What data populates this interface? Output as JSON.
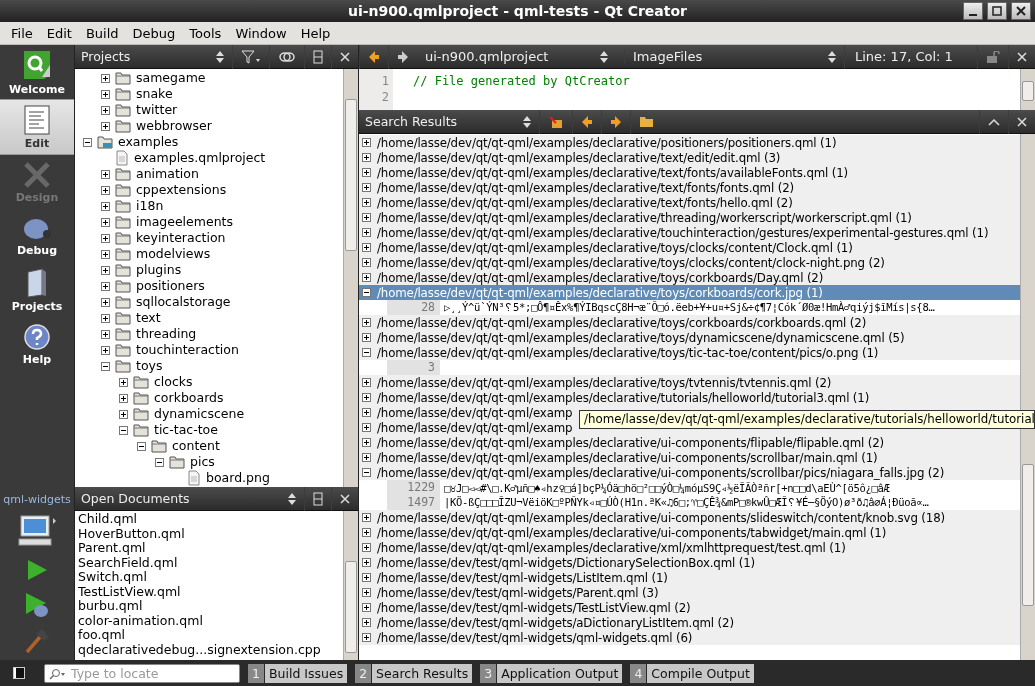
{
  "window": {
    "title": "ui-n900.qmlproject - qml-tests - Qt Creator"
  },
  "menu": [
    "File",
    "Edit",
    "Build",
    "Debug",
    "Tools",
    "Window",
    "Help"
  ],
  "modes": [
    {
      "kind": "welcome",
      "label": "Welcome",
      "selected": false,
      "disabled": false
    },
    {
      "kind": "edit",
      "label": "Edit",
      "selected": true,
      "disabled": false
    },
    {
      "kind": "design",
      "label": "Design",
      "selected": false,
      "disabled": true
    },
    {
      "kind": "debug",
      "label": "Debug",
      "selected": false,
      "disabled": false
    },
    {
      "kind": "projects",
      "label": "Projects",
      "selected": false,
      "disabled": false
    },
    {
      "kind": "help",
      "label": "Help",
      "selected": false,
      "disabled": false
    }
  ],
  "run_target": {
    "label": "qml-widgets"
  },
  "projects": {
    "title": "Projects",
    "tree": [
      {
        "children": [
          {
            "kind": "folder",
            "label": "samegame",
            "expanded": false
          },
          {
            "kind": "folder",
            "label": "snake",
            "expanded": false
          },
          {
            "kind": "folder",
            "label": "twitter",
            "expanded": false
          },
          {
            "kind": "folder",
            "label": "webbrowser",
            "expanded": false
          }
        ]
      },
      {
        "kind": "project",
        "label": "examples",
        "expanded": true,
        "children": [
          {
            "kind": "file",
            "label": "examples.qmlproject"
          },
          {
            "kind": "folder",
            "label": "animation",
            "expanded": false
          },
          {
            "kind": "folder",
            "label": "cppextensions",
            "expanded": false
          },
          {
            "kind": "folder",
            "label": "i18n",
            "expanded": false
          },
          {
            "kind": "folder",
            "label": "imageelements",
            "expanded": false
          },
          {
            "kind": "folder",
            "label": "keyinteraction",
            "expanded": false
          },
          {
            "kind": "folder",
            "label": "modelviews",
            "expanded": false
          },
          {
            "kind": "folder",
            "label": "plugins",
            "expanded": false
          },
          {
            "kind": "folder",
            "label": "positioners",
            "expanded": false
          },
          {
            "kind": "folder",
            "label": "sqllocalstorage",
            "expanded": false
          },
          {
            "kind": "folder",
            "label": "text",
            "expanded": false
          },
          {
            "kind": "folder",
            "label": "threading",
            "expanded": false
          },
          {
            "kind": "folder",
            "label": "touchinteraction",
            "expanded": false
          },
          {
            "kind": "folder",
            "label": "toys",
            "expanded": true,
            "children": [
              {
                "kind": "folder",
                "label": "clocks",
                "expanded": false
              },
              {
                "kind": "folder",
                "label": "corkboards",
                "expanded": false
              },
              {
                "kind": "folder",
                "label": "dynamicscene",
                "expanded": false
              },
              {
                "kind": "folder",
                "label": "tic-tac-toe",
                "expanded": true,
                "children": [
                  {
                    "kind": "folder",
                    "label": "content",
                    "expanded": true,
                    "children": [
                      {
                        "kind": "folder",
                        "label": "pics",
                        "expanded": true,
                        "children": [
                          {
                            "kind": "file",
                            "label": "board.png"
                          }
                        ]
                      }
                    ]
                  }
                ]
              }
            ]
          }
        ]
      }
    ]
  },
  "open_documents": {
    "title": "Open Documents",
    "items": [
      "Child.qml",
      "HoverButton.qml",
      "Parent.qml",
      "SearchField.qml",
      "Switch.qml",
      "TestListView.qml",
      "burbu.qml",
      "color-animation.qml",
      "foo.qml",
      "qdeclarativedebug...signextension.cpp"
    ]
  },
  "editor": {
    "project": "ui-n900.qmlproject",
    "file": "ImageFiles",
    "position": "Line: 17, Col: 1",
    "lines": [
      {
        "number": "1",
        "text": "// File generated by QtCreator"
      },
      {
        "number": "2"
      }
    ]
  },
  "search_results": {
    "title": "Search Results",
    "tooltip": "/home/lasse/dev/qt/qt-qml/examples/declarative/tutorials/helloworld/tutorial",
    "results": [
      {
        "text": "/home/lasse/dev/qt/qt-qml/examples/declarative/positioners/positioners.qml (1)",
        "expanded": false,
        "selected": false
      },
      {
        "text": "/home/lasse/dev/qt/qt-qml/examples/declarative/text/edit/edit.qml (3)",
        "expanded": false,
        "selected": false
      },
      {
        "text": "/home/lasse/dev/qt/qt-qml/examples/declarative/text/fonts/availableFonts.qml (1)",
        "expanded": false,
        "selected": false
      },
      {
        "text": "/home/lasse/dev/qt/qt-qml/examples/declarative/text/fonts/fonts.qml (2)",
        "expanded": false,
        "selected": false
      },
      {
        "text": "/home/lasse/dev/qt/qt-qml/examples/declarative/text/fonts/hello.qml (2)",
        "expanded": false,
        "selected": false
      },
      {
        "text": "/home/lasse/dev/qt/qt-qml/examples/declarative/threading/workerscript/workerscript.qml (1)",
        "expanded": false,
        "selected": false
      },
      {
        "text": "/home/lasse/dev/qt/qt-qml/examples/declarative/touchinteraction/gestures/experimental-gestures.qml (1)",
        "expanded": false,
        "selected": false
      },
      {
        "text": "/home/lasse/dev/qt/qt-qml/examples/declarative/toys/clocks/content/Clock.qml (1)",
        "expanded": false,
        "selected": false
      },
      {
        "text": "/home/lasse/dev/qt/qt-qml/examples/declarative/toys/clocks/content/clock-night.png (2)",
        "expanded": false,
        "selected": false
      },
      {
        "text": "/home/lasse/dev/qt/qt-qml/examples/declarative/toys/corkboards/Day.qml (2)",
        "expanded": false,
        "selected": false
      },
      {
        "text": "/home/lasse/dev/qt/qt-qml/examples/declarative/toys/corkboards/cork.jpg (1)",
        "expanded": true,
        "selected": true,
        "matches": [
          {
            "line": "28",
            "text": "▷¸¸Ý^ü`ÝN³␦5*;□Ô¶¤Êx%¶ÝIBqscÇ8H¬æ¨Õ□ó.ëeb+¥+u¤+Sj&÷¢¶7¦Cók´Ø0æ!HmÀ♂qiýj$ĩMís|s{8…"
          }
        ]
      },
      {
        "text": "/home/lasse/dev/qt/qt-qml/examples/declarative/toys/corkboards/corkboards.qml (2)",
        "expanded": false,
        "selected": false
      },
      {
        "text": "/home/lasse/dev/qt/qt-qml/examples/declarative/toys/dynamicscene/dynamicscene.qml (5)",
        "expanded": false,
        "selected": false
      },
      {
        "text": "/home/lasse/dev/qt/qt-qml/examples/declarative/toys/tic-tac-toe/content/pics/o.png (1)",
        "expanded": true,
        "selected": false,
        "matches": [
          {
            "line": "3"
          }
        ]
      },
      {
        "text": "/home/lasse/dev/qt/qt-qml/examples/declarative/toys/tvtennis/tvtennis.qml (2)",
        "expanded": false,
        "selected": false
      },
      {
        "text": "/home/lasse/dev/qt/qt-qml/examples/declarative/tutorials/helloworld/tutorial3.qml (1)",
        "expanded": false,
        "selected": false
      },
      {
        "text": "/home/lasse/dev/qt/qt-qml/examp",
        "expanded": false,
        "selected": false
      },
      {
        "text": "/home/lasse/dev/qt/qt-qml/examp",
        "expanded": false,
        "selected": false
      },
      {
        "text": "/home/lasse/dev/qt/qt-qml/examples/declarative/ui-components/flipable/flipable.qml (2)",
        "expanded": false,
        "selected": false
      },
      {
        "text": "/home/lasse/dev/qt/qt-qml/examples/declarative/ui-components/scrollbar/main.qml (1)",
        "expanded": false,
        "selected": false
      },
      {
        "text": "/home/lasse/dev/qt/qt-qml/examples/declarative/ui-components/scrollbar/pics/niagara_falls.jpg (2)",
        "expanded": true,
        "selected": false,
        "matches": [
          {
            "line": "1229",
            "text": "□♉J□◅◅#\\□.K♂µñ□♠◃hz♀□á]bçP¼Óä□hö□²□□ýÒ□¼móµS9Ç◃½ëĨÃÒªñr[+n□□d\\aEÙ^[ö5ô¿□âÆ"
          },
          {
            "line": "1497",
            "text": "|KÖ-ßÇ□□□ĨZU¬VëiöK□ºPÑYk◃¤□ÚÒ(H1n.ªK«♫6□;♈□ÇÊ¾&mP□®kwÛ□ÆĨ␦¥É─§ÖýO)ø³ð♫â⌀Á¦Ðüoã∝…"
          }
        ]
      },
      {
        "text": "/home/lasse/dev/qt/qt-qml/examples/declarative/ui-components/slideswitch/content/knob.svg (18)",
        "expanded": false,
        "selected": false
      },
      {
        "text": "/home/lasse/dev/qt/qt-qml/examples/declarative/ui-components/tabwidget/main.qml (1)",
        "expanded": false,
        "selected": false
      },
      {
        "text": "/home/lasse/dev/qt/qt-qml/examples/declarative/xml/xmlhttprequest/test.qml (1)",
        "expanded": false,
        "selected": false
      },
      {
        "text": "/home/lasse/dev/test/qml-widgets/DictionarySelectionBox.qml (1)",
        "expanded": false,
        "selected": false
      },
      {
        "text": "/home/lasse/dev/test/qml-widgets/ListItem.qml (1)",
        "expanded": false,
        "selected": false
      },
      {
        "text": "/home/lasse/dev/test/qml-widgets/Parent.qml (3)",
        "expanded": false,
        "selected": false
      },
      {
        "text": "/home/lasse/dev/test/qml-widgets/TestListView.qml (2)",
        "expanded": false,
        "selected": false
      },
      {
        "text": "/home/lasse/dev/test/qml-widgets/aDictionaryListItem.qml (2)",
        "expanded": false,
        "selected": false
      },
      {
        "text": "/home/lasse/dev/test/qml-widgets/qml-widgets.qml (6)",
        "expanded": false,
        "selected": false
      }
    ]
  },
  "locator": {
    "placeholder": "Type to locate"
  },
  "output_tabs": [
    {
      "number": "1",
      "label": "Build Issues"
    },
    {
      "number": "2",
      "label": "Search Results"
    },
    {
      "number": "3",
      "label": "Application Output"
    },
    {
      "number": "4",
      "label": "Compile Output"
    }
  ]
}
